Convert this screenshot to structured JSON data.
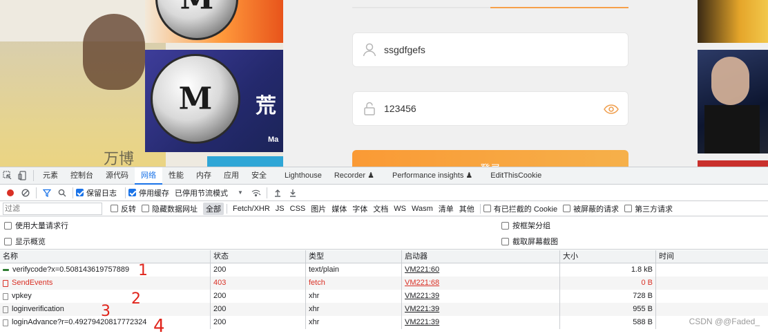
{
  "page": {
    "username_value": "ssgdfgefs",
    "password_value": "123456",
    "login_button": "登录",
    "promo_text": "荒",
    "promo_subtext": "Ma",
    "shirt_text": "万博"
  },
  "devtools": {
    "tabs": [
      "元素",
      "控制台",
      "源代码",
      "网络",
      "性能",
      "内存",
      "应用",
      "安全",
      "Lighthouse",
      "Recorder ♟",
      "Performance insights ♟",
      "EditThisCookie"
    ],
    "active_tab": "网络",
    "toolbar": {
      "preserve_log": "保留日志",
      "disable_cache": "停用缓存",
      "throttling": "已停用节流模式"
    },
    "filter": {
      "placeholder": "过滤",
      "invert": "反转",
      "hide_data_urls": "隐藏数据网址",
      "types": [
        "全部",
        "Fetch/XHR",
        "JS",
        "CSS",
        "图片",
        "媒体",
        "字体",
        "文档",
        "WS",
        "Wasm",
        "清单",
        "其他"
      ],
      "blocked_cookies": "有已拦截的 Cookie",
      "blocked_requests": "被屏蔽的请求",
      "third_party": "第三方请求"
    },
    "options": {
      "large_rows": "使用大量请求行",
      "overview": "显示概览",
      "group_by_frame": "按框架分组",
      "screenshots": "截取屏幕截图"
    },
    "columns": [
      "名称",
      "状态",
      "类型",
      "启动器",
      "大小",
      "时间"
    ],
    "rows": [
      {
        "name": "verifycode?x=0.508143619757889",
        "status": "200",
        "type": "text/plain",
        "initiator": "VM221:60",
        "size": "1.8 kB",
        "error": false,
        "icon": "green-bar-icon"
      },
      {
        "name": "SendEvents",
        "status": "403",
        "type": "fetch",
        "initiator": "VM221:68",
        "size": "0 B",
        "error": true,
        "icon": "document-icon"
      },
      {
        "name": "vpkey",
        "status": "200",
        "type": "xhr",
        "initiator": "VM221:39",
        "size": "728 B",
        "error": false,
        "icon": "document-icon"
      },
      {
        "name": "loginverification",
        "status": "200",
        "type": "xhr",
        "initiator": "VM221:39",
        "size": "955 B",
        "error": false,
        "icon": "document-icon"
      },
      {
        "name": "loginAdvance?r=0.49279420817772324",
        "status": "200",
        "type": "xhr",
        "initiator": "VM221:39",
        "size": "588 B",
        "error": false,
        "icon": "document-icon"
      }
    ]
  },
  "annotations": [
    "1",
    "2",
    "3",
    "4"
  ],
  "watermark": "CSDN @@Faded_"
}
